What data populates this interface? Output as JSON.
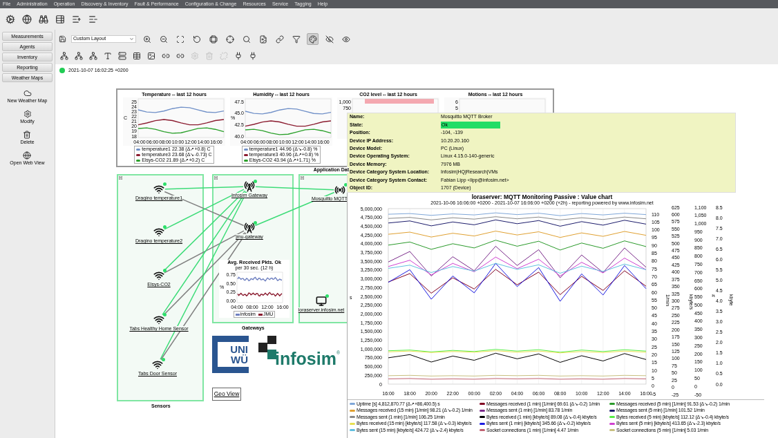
{
  "menu": [
    "File",
    "Administration",
    "Operation",
    "Discovery & Inventory",
    "Fault & Performance",
    "Configuration & Change",
    "Resources",
    "Service",
    "Tagging",
    "Help"
  ],
  "sidebar": {
    "tabs": [
      {
        "label": "Measurements"
      },
      {
        "label": "Agents"
      },
      {
        "label": "Inventory"
      },
      {
        "label": "Reporting"
      },
      {
        "label": "Weather Maps"
      }
    ],
    "actions": [
      {
        "label": "New Weather Map"
      },
      {
        "label": "Modify"
      },
      {
        "label": "Delete"
      },
      {
        "label": "Open Web View"
      }
    ]
  },
  "layout_select": "Custom Layout",
  "view_tools": [
    {
      "pressed": false
    },
    {
      "pressed": false
    },
    {
      "pressed": false
    },
    {
      "pressed": false
    },
    {
      "pressed": false
    },
    {
      "pressed": false
    },
    {
      "pressed": false
    },
    {
      "pressed": false
    },
    {
      "pressed": false
    },
    {
      "pressed": false
    },
    {
      "pressed": true
    },
    {
      "pressed": false
    },
    {
      "pressed": false
    }
  ],
  "edit_tools": [
    {
      "disabled": false
    },
    {
      "disabled": false
    },
    {
      "disabled": false
    },
    {
      "disabled": false
    },
    {
      "disabled": false
    },
    {
      "disabled": false
    },
    {
      "disabled": false
    },
    {
      "disabled": false
    },
    {
      "disabled": false
    },
    {
      "disabled": true
    },
    {
      "disabled": true
    },
    {
      "disabled": true
    },
    {
      "disabled": false
    },
    {
      "disabled": false
    }
  ],
  "status": {
    "ok": true,
    "timestamp": "2021-10-07 16:02:25 +0200"
  },
  "mini_charts": [
    {
      "title": "Temperature -- last 12 hours",
      "ylabel": "C",
      "yticks": [
        "25",
        "24",
        "23",
        "22",
        "21",
        "20",
        "19",
        "18"
      ],
      "xticks": [
        "04:00",
        "06:00",
        "08:00",
        "10:00",
        "12:00",
        "14:00",
        "16:00"
      ],
      "legend": [
        {
          "label": "temperature1 22.38 (Δ↗+0.8) C",
          "color": "#7090c8"
        },
        {
          "label": "temperature3 23.68 (Δ↘-0.73) C",
          "color": "#8a1a2e"
        },
        {
          "label": "Elsys-CO2 21.89 (Δ↗+0.2) C",
          "color": "#2aa02a"
        }
      ]
    },
    {
      "title": "Humidity -- last 12 hours",
      "ylabel": "%",
      "yticks": [
        "47.5",
        "45.0",
        "42.5",
        "40.0"
      ],
      "xticks": [
        "04:00",
        "06:00",
        "08:00",
        "10:00",
        "12:00",
        "14:00",
        "16:00"
      ],
      "legend": [
        {
          "label": "temperature1 44.96 (Δ↘-0.8) %",
          "color": "#7090c8"
        },
        {
          "label": "temperature3 40.96 (Δ↗+0.8) %",
          "color": "#8a1a2e"
        },
        {
          "label": "Elsys-CO2 43.94 (Δ↗+1.71) %",
          "color": "#2aa02a"
        }
      ]
    },
    {
      "title": "CO2 level -- last 12 hours",
      "yticks": [
        "1,000",
        "750"
      ],
      "alarm_zone": true
    },
    {
      "title": "Motions -- last 12 hours",
      "yticks": [
        "6",
        "5"
      ],
      "alarm_zone": false
    }
  ],
  "charts_caption": "Application Dat",
  "groups": [
    {
      "label": "Sensors",
      "expanded": true
    },
    {
      "label": "Gateways",
      "expanded": true
    },
    {
      "expanded": true
    }
  ],
  "nodes": [
    {
      "kind": "sensor",
      "label": "Dragino temperature1"
    },
    {
      "kind": "sensor",
      "label": "Dragino temperature2"
    },
    {
      "kind": "sensor",
      "label": "Elsys-CO2"
    },
    {
      "kind": "sensor",
      "label": "Tabs Healthy Home Sensor"
    },
    {
      "kind": "sensor",
      "label": "Tabs Door Sensor"
    },
    {
      "kind": "gateway",
      "label": "Infosim Gateway"
    },
    {
      "kind": "gateway",
      "label": "jmu-gateway"
    },
    {
      "kind": "broker",
      "label": "Mosquitto MQTT"
    },
    {
      "kind": "server",
      "label": "loraserver.infosim.net"
    }
  ],
  "links": [
    {
      "color": "#3ddc78"
    },
    {
      "color": "#3ddc78"
    },
    {
      "color": "#808080"
    },
    {
      "color": "#3ddc78"
    },
    {
      "color": "#3ddc78"
    },
    {
      "color": "#808080"
    },
    {
      "color": "#3ddc78"
    },
    {
      "color": "#808080"
    },
    {
      "color": "#3ddc78"
    },
    {
      "color": "#808080"
    },
    {
      "color": "#3ddc78"
    }
  ],
  "avg_chart": {
    "title": "Avg. Received Pkts. Ok",
    "subtitle": "per 30 sec. (12 h)",
    "ylabel": "%",
    "yticks": [
      "0.75",
      "0.50",
      "0.25",
      "0.00"
    ],
    "xticks": [
      "04:00",
      "08:00",
      "12:00",
      "16:00"
    ],
    "legend": [
      {
        "label": "infosim",
        "color": "#6f80c0"
      },
      {
        "label": "JMU",
        "color": "#8a1a2e"
      }
    ]
  },
  "uni_logo": {
    "line_1": "UNI",
    "line_2": "WÜ"
  },
  "infosim_logo": {
    "name": "infosim",
    "mark": "®"
  },
  "geo_view_button": "Geo View",
  "device_info": [
    {
      "kind": "text",
      "label": "Name:",
      "value": "Mosquitto MQTT Broker"
    },
    {
      "kind": "state",
      "label": "State:",
      "value": "Ok"
    },
    {
      "kind": "text",
      "label": "Position:",
      "value": "-104, -139"
    },
    {
      "kind": "text",
      "label": "Device IP Address:",
      "value": "10.20.20.160"
    },
    {
      "kind": "text",
      "label": "Device Model:",
      "value": "PC (Linux)"
    },
    {
      "kind": "text",
      "label": "Device Operating System:",
      "value": "Linux 4.15.0-140-generic"
    },
    {
      "kind": "text",
      "label": "Device Memory:",
      "value": "7976 MB"
    },
    {
      "kind": "text",
      "label": "Device Category System Location:",
      "value": "Infosim|HQ|Research|VMs"
    },
    {
      "kind": "text",
      "label": "Device Category System Contact:",
      "value": "Fabian Lipp <lipp@infosim.net>"
    },
    {
      "kind": "text",
      "label": "Object ID:",
      "value": "1707 (Device)"
    }
  ],
  "value_chart": {
    "title": "loraserver: MQTT Monitoring Passive : Value chart",
    "subtitle": "2021-10-06 16:06:00 +0200 - 2021-10-07 16:06:00 +0200 (+2h) - reporting powered by www.infosim.net",
    "chart_data": {
      "type": "line",
      "grid": true,
      "ylabel": "s",
      "ylim": [
        0,
        5000000
      ],
      "x": [
        "16:00",
        "18:00",
        "20:00",
        "22:00",
        "00:00",
        "02:00",
        "04:00",
        "06:00",
        "08:00",
        "10:00",
        "12:00",
        "14:00",
        "16:00"
      ],
      "yticks": [
        {
          "value": 5000000,
          "label": "5,000,000"
        },
        {
          "value": 4750000,
          "label": "4,750,000"
        },
        {
          "value": 4500000,
          "label": "4,500,000"
        },
        {
          "value": 4250000,
          "label": "4,250,000"
        },
        {
          "value": 4000000,
          "label": "4,000,000"
        },
        {
          "value": 3750000,
          "label": "3,750,000"
        },
        {
          "value": 3500000,
          "label": "3,500,000"
        },
        {
          "value": 3250000,
          "label": "3,250,000"
        },
        {
          "value": 3000000,
          "label": "3,000,000"
        },
        {
          "value": 2750000,
          "label": "2,750,000"
        },
        {
          "value": 2500000,
          "label": "2,500,000"
        },
        {
          "value": 2250000,
          "label": "2,250,000"
        },
        {
          "value": 2000000,
          "label": "2,000,000"
        },
        {
          "value": 1750000,
          "label": "1,750,000"
        },
        {
          "value": 1500000,
          "label": "1,500,000"
        },
        {
          "value": 1250000,
          "label": "1,250,000"
        },
        {
          "value": 1000000,
          "label": "1,000,000"
        },
        {
          "value": 750000,
          "label": "750,000"
        },
        {
          "value": 500000,
          "label": "500,000"
        },
        {
          "value": 250000,
          "label": "250,000"
        },
        {
          "value": 0,
          "label": "0"
        }
      ],
      "series": [
        {
          "name": "Uptime [s] 4,812,870.77 (Δ↗+86,400.5) s",
          "color": "#7ea6d8",
          "values": [
            4840000,
            4860000,
            4810000,
            4850000,
            4820000,
            4880000,
            4830000,
            4870000,
            4800000,
            4860000,
            4820000,
            4870000,
            4830000
          ]
        },
        {
          "name": "Messages received (1 min) [1/min] 69.61 (Δ↘-0.2) 1/min",
          "color": "#800020",
          "values": [
            2910000,
            3150000,
            2590000,
            3030000,
            2710000,
            3270000,
            2830000,
            3190000,
            2550000,
            3070000,
            2670000,
            3230000,
            2790000
          ]
        },
        {
          "name": "Messages received (5 min) [1/min] 91.53 (Δ↘-0.2) 1/min",
          "color": "#2a9a2a",
          "values": [
            3960000,
            4050000,
            3840000,
            4000000,
            3880000,
            4100000,
            3930000,
            4070000,
            3820000,
            4020000,
            3870000,
            4080000,
            3920000
          ]
        },
        {
          "name": "Messages received (15 min) [1/min] 98.21 (Δ↘-0.2) 1/min",
          "color": "#e0a030",
          "values": [
            4270000,
            4330000,
            4190000,
            4300000,
            4220000,
            4360000,
            4250000,
            4340000,
            4180000,
            4310000,
            4210000,
            4350000,
            4240000
          ]
        },
        {
          "name": "Messages sent (1 min) [1/min] 83.78 1/min",
          "color": "#7a2a8a",
          "values": [
            3480000,
            3780000,
            3080000,
            3630000,
            3230000,
            3930000,
            3380000,
            3830000,
            3030000,
            3680000,
            3180000,
            3880000,
            3330000
          ]
        },
        {
          "name": "Messages sent (5 min) [1/min] 101.52 1/min",
          "color": "#1a1a6a",
          "values": [
            4590000,
            4650000,
            4510000,
            4620000,
            4540000,
            4680000,
            4570000,
            4660000,
            4500000,
            4630000,
            4530000,
            4670000,
            4560000
          ]
        },
        {
          "name": "Messages sent (1 min) [1/min] 106.25 1/min",
          "color": "#888888",
          "values": [
            4720000,
            4750000,
            4680000,
            4740000,
            4700000,
            4770000,
            4710000,
            4760000,
            4680000,
            4740000,
            4690000,
            4760000,
            4710000
          ]
        },
        {
          "name": "Bytes received (1 min) [kbyte/s] 89.08 (Δ↘-0.4) kbyte/s",
          "color": "#000000",
          "values": [
            750000,
            840000,
            630000,
            800000,
            680000,
            880000,
            720000,
            860000,
            620000,
            810000,
            660000,
            870000,
            700000
          ]
        },
        {
          "name": "Bytes received (5 min) [kbyte/s] 112.12 (Δ↘-0.4) kbyte/s",
          "color": "#55ee44",
          "values": [
            950000,
            970000,
            920000,
            960000,
            930000,
            990000,
            940000,
            980000,
            910000,
            970000,
            930000,
            980000,
            940000
          ]
        },
        {
          "name": "Bytes received (15 min) [kbyte/s] 117.58 (Δ↘-0.3) kbyte/s",
          "color": "#e8e050",
          "values": [
            920000,
            940000,
            900000,
            930000,
            910000,
            950000,
            910000,
            940000,
            890000,
            930000,
            900000,
            940000,
            910000
          ]
        },
        {
          "name": "Bytes sent (1 min) [kbyte/s] 345.66 (Δ↘-0.2) kbyte/s",
          "color": "#1a1ae0",
          "values": [
            2900000,
            3260000,
            2420000,
            3080000,
            2600000,
            3440000,
            2780000,
            3320000,
            2360000,
            3140000,
            2540000,
            3380000,
            2720000
          ]
        },
        {
          "name": "Bytes sent (5 min) [kbyte/s] 413.65 (Δ↘-2.3) kbyte/s",
          "color": "#d040d0",
          "values": [
            3350000,
            3530000,
            3110000,
            3440000,
            3200000,
            3620000,
            3290000,
            3560000,
            3080000,
            3470000,
            3170000,
            3590000,
            3260000
          ]
        },
        {
          "name": "Bytes sent (15 min) [kbyte/s] 424.72 (Δ↘-2.4) kbyte/s",
          "color": "#60c0e0",
          "values": [
            3300000,
            3390000,
            3180000,
            3350000,
            3220000,
            3440000,
            3270000,
            3400000,
            3160000,
            3360000,
            3210000,
            3420000,
            3260000
          ]
        },
        {
          "name": "Socket connections (1 min) [1/min] 4.47 1/min",
          "color": "#c06070",
          "values": [
            150000,
            160000,
            140000,
            150000,
            140000,
            160000,
            150000,
            160000,
            140000,
            150000,
            140000,
            160000,
            150000
          ]
        },
        {
          "name": "Socket connections (5 min) [1/min] 5.03 1/min",
          "color": "#c8c080",
          "values": [
            240000,
            250000,
            230000,
            240000,
            230000,
            250000,
            240000,
            250000,
            230000,
            240000,
            230000,
            250000,
            240000
          ]
        }
      ]
    },
    "secondary_axes": [
      {
        "title": "1/min",
        "ticks": [
          "110",
          "105",
          "100",
          "95",
          "90",
          "85",
          "80",
          "75",
          "70",
          "65",
          "60",
          "55",
          "50",
          "45",
          "40",
          "35",
          "30",
          "25",
          "20",
          "15",
          "10",
          "5",
          "0",
          "-5"
        ]
      },
      {
        "title": "kbyte/s",
        "ticks": [
          "625",
          "600",
          "575",
          "550",
          "525",
          "500",
          "475",
          "450",
          "425",
          "400",
          "375",
          "350",
          "325",
          "300",
          "275",
          "250",
          "225",
          "200",
          "175",
          "150",
          "125",
          "100",
          "75",
          "50",
          "25",
          "0",
          "-25"
        ]
      },
      {
        "title": "#",
        "ticks": [
          "1,100",
          "1,050",
          "1,000",
          "950",
          "900",
          "850",
          "800",
          "750",
          "700",
          "650",
          "600",
          "550",
          "500",
          "450",
          "400",
          "350",
          "300",
          "250",
          "200",
          "150",
          "100",
          "50",
          "0",
          "-50"
        ]
      },
      {
        "title": "kbyte",
        "ticks": [
          "8.5",
          "8.0",
          "7.5",
          "7.0",
          "6.5",
          "6.0",
          "5.5",
          "5.0",
          "4.5",
          "4.0",
          "3.5",
          "3.0",
          "2.5",
          "2.0",
          "1.5",
          "1.0",
          "0.5",
          "0.0"
        ]
      }
    ]
  }
}
